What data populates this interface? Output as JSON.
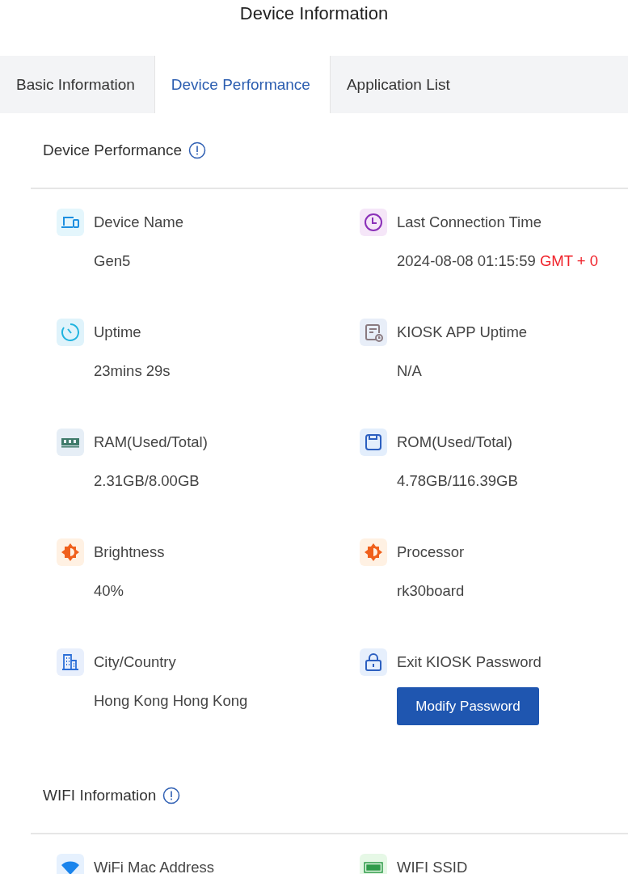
{
  "title": "Device Information",
  "tabs": [
    {
      "label": "Basic Information",
      "selected": false
    },
    {
      "label": "Device Performance",
      "selected": true
    },
    {
      "label": "Application List",
      "selected": false
    }
  ],
  "sections": [
    {
      "heading": "Device Performance",
      "items": [
        {
          "kind": "text",
          "label": "Device Name",
          "value": "Gen5"
        },
        {
          "kind": "text",
          "label": "Last Connection Time",
          "value": "2024-08-08 01:15:59",
          "note": "GMT + 0"
        },
        {
          "kind": "text",
          "label": "Uptime",
          "value": "23mins 29s"
        },
        {
          "kind": "text",
          "label": "KIOSK APP Uptime",
          "value": "N/A"
        },
        {
          "kind": "text",
          "label": "RAM(Used/Total)",
          "value": "2.31GB/8.00GB"
        },
        {
          "kind": "text",
          "label": "ROM(Used/Total)",
          "value": "4.78GB/116.39GB"
        },
        {
          "kind": "text",
          "label": "Brightness",
          "value": "40%"
        },
        {
          "kind": "text",
          "label": "Processor",
          "value": "rk30board"
        },
        {
          "kind": "text",
          "label": "City/Country",
          "value": "Hong Kong Hong Kong"
        },
        {
          "kind": "button",
          "label": "Exit KIOSK Password",
          "button": "Modify Password"
        }
      ]
    },
    {
      "heading": "WIFI Information",
      "items": [
        {
          "kind": "label",
          "label": "WiFi Mac Address"
        },
        {
          "kind": "label",
          "label": "WIFI SSID"
        }
      ]
    }
  ]
}
